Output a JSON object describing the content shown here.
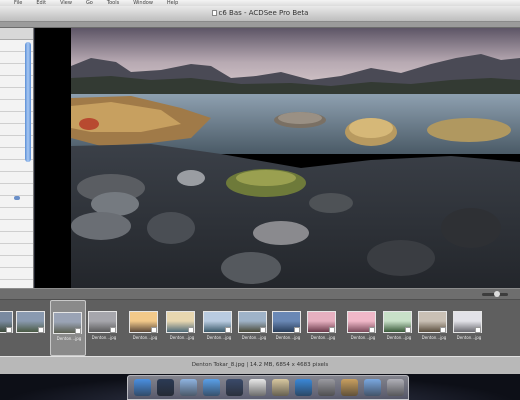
{
  "menubar": {
    "items": [
      "File",
      "Edit",
      "View",
      "Go",
      "Tools",
      "Window",
      "Help"
    ]
  },
  "window": {
    "title": "c6 Bas - ACDSee Pro Beta"
  },
  "filmstrip": {
    "items": [
      {
        "label": "",
        "selected": false,
        "colors": [
          "#7a8aa0",
          "#3d4a3a"
        ]
      },
      {
        "label": "",
        "selected": false,
        "colors": [
          "#8a9ab0",
          "#4a5a44"
        ]
      },
      {
        "label": "Denton...jpg",
        "selected": true,
        "colors": [
          "#9aa3b5",
          "#5a5e50"
        ]
      },
      {
        "label": "Denton...jpg",
        "selected": false,
        "colors": [
          "#a6a6ac",
          "#5b5b5b"
        ]
      },
      {
        "label": "Denton...jpg",
        "selected": false,
        "colors": [
          "#f2c98a",
          "#5d4a3a"
        ]
      },
      {
        "label": "Denton...jpg",
        "selected": false,
        "colors": [
          "#e8d7b0",
          "#4e6a78"
        ]
      },
      {
        "label": "Denton...jpg",
        "selected": false,
        "colors": [
          "#b9cbe0",
          "#3c5a6a"
        ]
      },
      {
        "label": "Denton...jpg",
        "selected": false,
        "colors": [
          "#9fb3c8",
          "#4a4a3a"
        ]
      },
      {
        "label": "Denton...jpg",
        "selected": false,
        "colors": [
          "#6a88b5",
          "#2a3e5a"
        ]
      },
      {
        "label": "Denton...jpg",
        "selected": false,
        "colors": [
          "#e6b0c0",
          "#6a3a4a"
        ]
      },
      {
        "label": "Denton...jpg",
        "selected": false,
        "colors": [
          "#f0b8c8",
          "#7a4a5a"
        ]
      },
      {
        "label": "Denton...jpg",
        "selected": false,
        "colors": [
          "#c8e0c8",
          "#3a5a3a"
        ]
      },
      {
        "label": "Denton...jpg",
        "selected": false,
        "colors": [
          "#c9c0b5",
          "#5a4e3e"
        ]
      },
      {
        "label": "Denton...jpg",
        "selected": false,
        "colors": [
          "#e2e2e8",
          "#6a6a70"
        ]
      }
    ]
  },
  "status": {
    "text": "Denton Tokar_8.jpg | 14.2 MB, 6854 x 4683 pixels"
  },
  "dock": {
    "icons": [
      {
        "name": "finder-icon",
        "color": "#4a8fe0"
      },
      {
        "name": "dashboard-icon",
        "color": "#2b3a55"
      },
      {
        "name": "mail-icon",
        "color": "#8fb4e0"
      },
      {
        "name": "itunes-icon",
        "color": "#5aa0e8"
      },
      {
        "name": "spaces-icon",
        "color": "#3a4a6a"
      },
      {
        "name": "calendar-icon",
        "color": "#e8e8e8"
      },
      {
        "name": "preview-icon",
        "color": "#d8c8a0"
      },
      {
        "name": "safari-icon",
        "color": "#3a88d8"
      },
      {
        "name": "system-prefs-icon",
        "color": "#9a9aa0"
      },
      {
        "name": "address-book-icon",
        "color": "#c9a060"
      },
      {
        "name": "folder-icon",
        "color": "#7aa8e0"
      },
      {
        "name": "trash-icon",
        "color": "#b0b0b8"
      }
    ]
  }
}
